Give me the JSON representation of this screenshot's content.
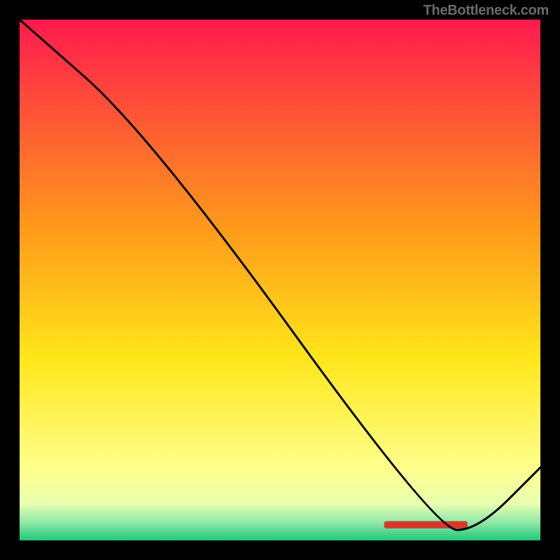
{
  "watermark": "TheBottleneck.com",
  "chart_data": {
    "type": "line",
    "title": "",
    "xlabel": "",
    "ylabel": "",
    "xlim": [
      0,
      100
    ],
    "ylim": [
      0,
      100
    ],
    "gradient_stops": [
      {
        "offset": 0,
        "color": "#ff1a4d"
      },
      {
        "offset": 0.4,
        "color": "#ff9a1a"
      },
      {
        "offset": 0.65,
        "color": "#ffe61a"
      },
      {
        "offset": 0.86,
        "color": "#ffff8a"
      },
      {
        "offset": 0.93,
        "color": "#e8ffb0"
      },
      {
        "offset": 0.965,
        "color": "#8fe8a8"
      },
      {
        "offset": 1.0,
        "color": "#22c878"
      }
    ],
    "series": [
      {
        "name": "curve",
        "x": [
          0,
          25,
          80,
          88,
          100
        ],
        "y": [
          100,
          78,
          2,
          2,
          14
        ]
      }
    ],
    "band": {
      "x_start": 70,
      "x_end": 86,
      "y": 3,
      "color": "#d43a2a",
      "height_pct": 1.4
    }
  }
}
